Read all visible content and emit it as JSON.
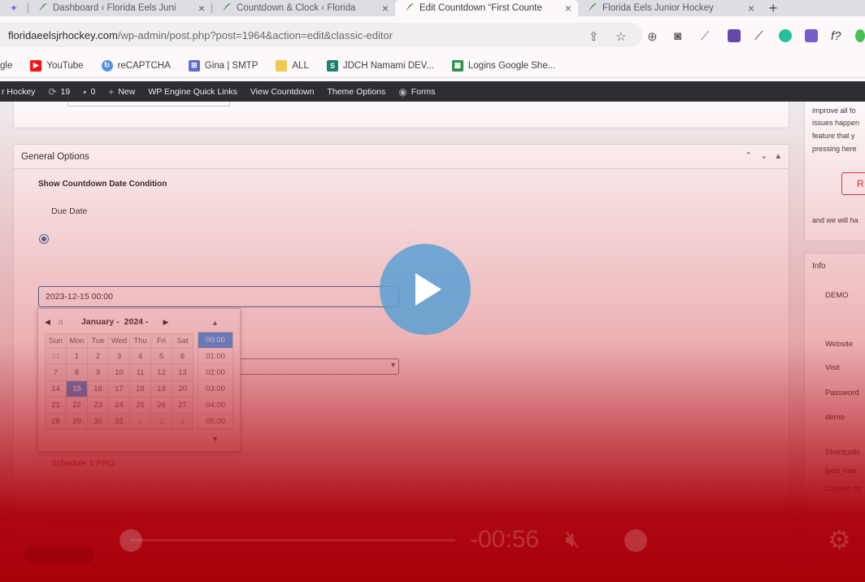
{
  "browser": {
    "tabs": [
      {
        "label": "Dashboard ‹ Florida Eels Juni"
      },
      {
        "label": "Countdown & Clock ‹ Florida"
      },
      {
        "label": "Edit Countdown “First Counte"
      },
      {
        "label": "Florida Eels Junior Hockey"
      }
    ],
    "url_host": "floridaeelsjrhockey.com",
    "url_path": "/wp-admin/post.php?post=1964&action=edit&classic-editor",
    "bookmarks": [
      "gle",
      "YouTube",
      "reCAPTCHA",
      "Gina | SMTP",
      "ALL",
      "JDCH Namami DEV...",
      "Logins Google She..."
    ]
  },
  "wp_admin_bar": {
    "site": "r Hockey",
    "updates": "19",
    "comments": "0",
    "new": "New",
    "wp_engine": "WP Engine Quick Links",
    "view": "View Countdown",
    "theme": "Theme Options",
    "forms": "Forms"
  },
  "panel": {
    "title": "General Options",
    "field_label": "Show Countdown Date Condition",
    "radio_label": "Due Date",
    "date_value": "2023-12-15 00:00",
    "schedule_1": "Schedule 1 PRO",
    "schedule_2": "Schedule 2 PRO"
  },
  "datepicker": {
    "month": "January -",
    "year": "2024 -",
    "weekdays": [
      "Sun",
      "Mon",
      "Tue",
      "Wed",
      "Thu",
      "Fri",
      "Sat"
    ],
    "weeks": [
      [
        "31",
        "1",
        "2",
        "3",
        "4",
        "5",
        "6"
      ],
      [
        "7",
        "8",
        "9",
        "10",
        "11",
        "12",
        "13"
      ],
      [
        "14",
        "15",
        "16",
        "17",
        "18",
        "19",
        "20"
      ],
      [
        "21",
        "22",
        "23",
        "24",
        "25",
        "26",
        "27"
      ],
      [
        "28",
        "29",
        "30",
        "31",
        "1",
        "2",
        "3"
      ]
    ],
    "selected_day": "15",
    "times": [
      "00:00",
      "01:00",
      "02:00",
      "03:00",
      "04:00",
      "05:00"
    ],
    "selected_time": "00:00"
  },
  "sidebar": {
    "lines": [
      "improve all fo",
      "issues happen",
      "feature that y",
      "pressing here"
    ],
    "button": "R",
    "note": "and we will ha",
    "info_title": "Info",
    "demo_label": "DEMO",
    "website": "Website",
    "visit": "Visit",
    "password": "Password",
    "password_value": "demo",
    "shortcode": "Shortcode",
    "shortcode_value": "[ycd_cou",
    "shortcode_hint": "Current co"
  },
  "video": {
    "time": "-00:56"
  }
}
